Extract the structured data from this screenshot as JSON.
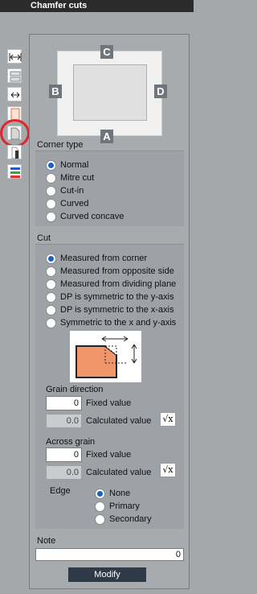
{
  "window": {
    "title": "Chamfer cuts"
  },
  "toolstrip": {
    "tools": [
      "double-arrow-icon",
      "stacked-panel-icon",
      "double-arrow-small-icon",
      "panel-outline-icon",
      "chamfer-panel-icon",
      "edge-panel-icon",
      "color-bars-icon"
    ],
    "selected": "chamfer-panel-icon"
  },
  "preview": {
    "edges": {
      "top": "C",
      "left": "B",
      "right": "D",
      "bottom": "A"
    }
  },
  "corner_type": {
    "label": "Corner type",
    "options": [
      "Normal",
      "Mitre cut",
      "Cut-in",
      "Curved",
      "Curved concave"
    ],
    "selected": "Normal"
  },
  "cut": {
    "label": "Cut",
    "options": [
      "Measured from corner",
      "Measured from opposite side",
      "Measured from dividing plane",
      "DP is symmetric to the y-axis",
      "DP is symmetric to the x-axis",
      "Symmetric to the x and y-axis"
    ],
    "selected": "Measured from corner",
    "grain_direction": {
      "label": "Grain direction",
      "fixed_value": "0",
      "fixed_label": "Fixed value",
      "calculated_value": "0.0",
      "calculated_label": "Calculated value",
      "sqrt_label": "√x"
    },
    "across_grain": {
      "label": "Across grain",
      "fixed_value": "0",
      "fixed_label": "Fixed value",
      "calculated_value": "0.0",
      "calculated_label": "Calculated value",
      "sqrt_label": "√x"
    },
    "edge": {
      "label": "Edge",
      "options": [
        "None",
        "Primary",
        "Secondary"
      ],
      "selected": "None"
    }
  },
  "note": {
    "label": "Note",
    "value": "0"
  },
  "modify_button": "Modify",
  "colors": {
    "accent": "#1565c0",
    "highlight_circle": "#e0262c",
    "diagram_fill": "#f0956a",
    "button_bg": "#2e3a48"
  }
}
